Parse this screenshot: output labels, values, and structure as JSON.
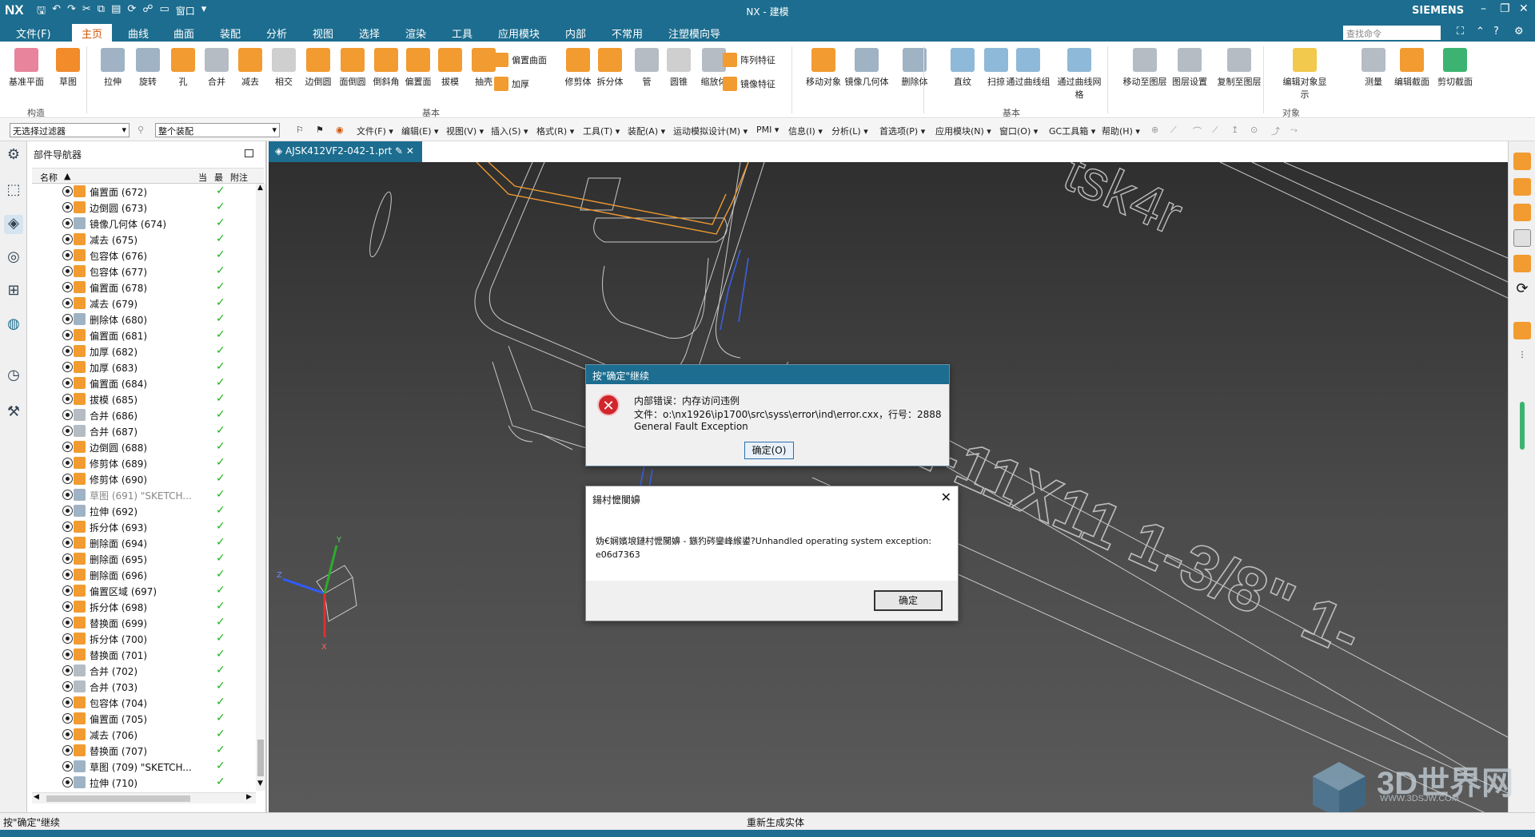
{
  "title_bar": {
    "logo": "NX",
    "window_menu": "窗口",
    "title": "NX - 建模",
    "brand": "SIEMENS"
  },
  "menu": {
    "tabs": [
      "文件(F)",
      "主页",
      "曲线",
      "曲面",
      "装配",
      "分析",
      "视图",
      "选择",
      "渲染",
      "工具",
      "应用模块",
      "内部",
      "不常用",
      "注塑模向导"
    ],
    "active": "主页",
    "search_placeholder": "查找命令"
  },
  "ribbon": {
    "big_buttons": [
      {
        "label": "基准平面",
        "color": "#e8849b"
      },
      {
        "label": "草图",
        "color": "#f28b2a"
      },
      {
        "label": "拉伸",
        "color": "#9fb3c4"
      },
      {
        "label": "旋转",
        "color": "#9fb3c4"
      },
      {
        "label": "孔",
        "color": "#f29b30"
      },
      {
        "label": "合并",
        "color": "#b5bcc4"
      },
      {
        "label": "减去",
        "color": "#f29b30"
      },
      {
        "label": "相交",
        "color": "#cfcfcf"
      },
      {
        "label": "边倒圆",
        "color": "#f29b30"
      },
      {
        "label": "面倒圆",
        "color": "#f29b30"
      },
      {
        "label": "倒斜角",
        "color": "#f29b30"
      },
      {
        "label": "偏置面",
        "color": "#f29b30"
      },
      {
        "label": "拔模",
        "color": "#f29b30"
      },
      {
        "label": "抽壳",
        "color": "#f29b30"
      },
      {
        "label": "修剪体",
        "color": "#f29b30"
      },
      {
        "label": "拆分体",
        "color": "#f29b30"
      },
      {
        "label": "管",
        "color": "#b5bcc4"
      },
      {
        "label": "圆锥",
        "color": "#cfcfcf"
      },
      {
        "label": "缩放体",
        "color": "#b5bcc4"
      },
      {
        "label": "移动对象",
        "color": "#f29b30"
      },
      {
        "label": "镜像几何体",
        "color": "#9fb3c4"
      },
      {
        "label": "删除体",
        "color": "#9fb3c4"
      },
      {
        "label": "直纹",
        "color": "#8fb9d8"
      },
      {
        "label": "扫掠",
        "color": "#8fb9d8"
      },
      {
        "label": "通过曲线组",
        "color": "#8fb9d8"
      },
      {
        "label": "通过曲线网格",
        "color": "#8fb9d8"
      },
      {
        "label": "移动至图层",
        "color": "#b5bcc4"
      },
      {
        "label": "图层设置",
        "color": "#b5bcc4"
      },
      {
        "label": "复制至图层",
        "color": "#b5bcc4"
      },
      {
        "label": "编辑对象显示",
        "color": "#f2c94c"
      },
      {
        "label": "测量",
        "color": "#b5bcc4"
      },
      {
        "label": "编辑截面",
        "color": "#f29b30"
      },
      {
        "label": "剪切截面",
        "color": "#3cb371"
      }
    ],
    "small_buttons": [
      {
        "label": "偏置曲面",
        "color": "#f29b30"
      },
      {
        "label": "加厚",
        "color": "#f29b30"
      },
      {
        "label": "阵列特征",
        "color": "#f29b30"
      },
      {
        "label": "镜像特征",
        "color": "#f29b30"
      }
    ],
    "groups": [
      "构造",
      "基本",
      "基本",
      "对象"
    ]
  },
  "toolbar2": {
    "filter": "无选择过滤器",
    "scope": "整个装配",
    "menus": [
      "文件(F)",
      "编辑(E)",
      "视图(V)",
      "插入(S)",
      "格式(R)",
      "工具(T)",
      "装配(A)",
      "运动模拟设计(M)",
      "PMI",
      "信息(I)",
      "分析(L)",
      "首选项(P)",
      "应用模块(N)",
      "窗口(O)",
      "GC工具箱",
      "帮助(H)"
    ]
  },
  "navigator": {
    "title": "部件导航器",
    "columns": [
      "名称",
      "当",
      "最",
      "附注"
    ],
    "rows": [
      {
        "name": "偏置面 (672)",
        "color": "#f29b30"
      },
      {
        "name": "边倒圆 (673)",
        "color": "#f29b30"
      },
      {
        "name": "镜像几何体 (674)",
        "color": "#9fb3c4"
      },
      {
        "name": "减去 (675)",
        "color": "#f29b30"
      },
      {
        "name": "包容体 (676)",
        "color": "#f29b30"
      },
      {
        "name": "包容体 (677)",
        "color": "#f29b30"
      },
      {
        "name": "偏置面 (678)",
        "color": "#f29b30"
      },
      {
        "name": "减去 (679)",
        "color": "#f29b30"
      },
      {
        "name": "删除体 (680)",
        "color": "#9fb3c4"
      },
      {
        "name": "偏置面 (681)",
        "color": "#f29b30"
      },
      {
        "name": "加厚 (682)",
        "color": "#f29b30"
      },
      {
        "name": "加厚 (683)",
        "color": "#f29b30"
      },
      {
        "name": "偏置面 (684)",
        "color": "#f29b30"
      },
      {
        "name": "拔模 (685)",
        "color": "#f29b30"
      },
      {
        "name": "合并 (686)",
        "color": "#b5bcc4"
      },
      {
        "name": "合并 (687)",
        "color": "#b5bcc4"
      },
      {
        "name": "边倒圆 (688)",
        "color": "#f29b30"
      },
      {
        "name": "修剪体 (689)",
        "color": "#f29b30"
      },
      {
        "name": "修剪体 (690)",
        "color": "#f29b30"
      },
      {
        "name": "草图 (691) \"SKETCH...",
        "color": "#9fb3c4",
        "dim": true
      },
      {
        "name": "拉伸 (692)",
        "color": "#9fb3c4"
      },
      {
        "name": "拆分体 (693)",
        "color": "#f29b30"
      },
      {
        "name": "删除面 (694)",
        "color": "#f29b30"
      },
      {
        "name": "删除面 (695)",
        "color": "#f29b30"
      },
      {
        "name": "删除面 (696)",
        "color": "#f29b30"
      },
      {
        "name": "偏置区域 (697)",
        "color": "#f29b30"
      },
      {
        "name": "拆分体 (698)",
        "color": "#f29b30"
      },
      {
        "name": "替换面 (699)",
        "color": "#f29b30"
      },
      {
        "name": "拆分体 (700)",
        "color": "#f29b30"
      },
      {
        "name": "替换面 (701)",
        "color": "#f29b30"
      },
      {
        "name": "合并 (702)",
        "color": "#b5bcc4"
      },
      {
        "name": "合并 (703)",
        "color": "#b5bcc4"
      },
      {
        "name": "包容体 (704)",
        "color": "#f29b30"
      },
      {
        "name": "偏置面 (705)",
        "color": "#f29b30"
      },
      {
        "name": "减去 (706)",
        "color": "#f29b30"
      },
      {
        "name": "替换面 (707)",
        "color": "#f29b30"
      },
      {
        "name": "草图 (709) \"SKETCH...",
        "color": "#9fb3c4"
      },
      {
        "name": "拉伸 (710)",
        "color": "#9fb3c4"
      }
    ]
  },
  "doc_tab": "AJSK412VF2-042-1.prt",
  "viewport_text": "1-11X11 1-3/8\" 1-",
  "dialog_error": {
    "title": "按\"确定\"继续",
    "line1": "内部错误：内存访问违例",
    "line2": "文件：o:\\nx1926\\ip1700\\src\\syss\\error\\ind\\error.cxx，行号：2888",
    "line3": "General Fault Exception",
    "ok": "确定(O)"
  },
  "dialog_garbled": {
    "title": "鍚村懡闃嬶",
    "message": "妫€娴嬪埌鏈村懡闃嬶     - 鏃犳硶鑾峰緱鍙?Unhandled operating system exception: e06d7363",
    "ok": "确定"
  },
  "status": {
    "left": "按\"确定\"继续",
    "center": "重新生成实体"
  },
  "watermark": {
    "text": "3D世界网",
    "sub": "WWW.3DSJW.COM"
  }
}
